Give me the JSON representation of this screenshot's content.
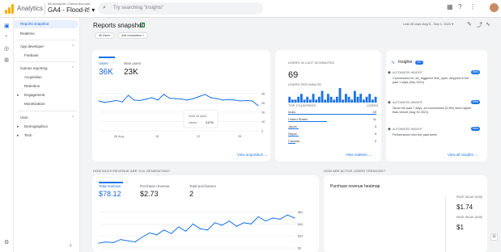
{
  "topbar": {
    "app_title": "Analytics",
    "account_path": "All accounts > Demo Account",
    "property": "GA4 - Flood-it! ▾",
    "search_placeholder": "Try searching \"insights\""
  },
  "nav": {
    "items": [
      {
        "label": "Reports snapshot"
      },
      {
        "label": "Realtime"
      },
      {
        "label": "App developer"
      },
      {
        "label": "Firebase"
      },
      {
        "label": "Games reporting"
      },
      {
        "label": "Acquisition"
      },
      {
        "label": "Retention"
      },
      {
        "label": "Engagement"
      },
      {
        "label": "Monetization"
      },
      {
        "label": "User"
      },
      {
        "label": "Demographics"
      },
      {
        "label": "Tech"
      }
    ]
  },
  "page": {
    "title": "Reports snapshot",
    "chip_comparison": "All Users",
    "chip_add": "Add comparison +",
    "date_range": "Last 28 days  Aug 5 - Sep 1, 2021 ▾"
  },
  "users_card": {
    "metrics": [
      {
        "label": "Users",
        "value": "36K"
      },
      {
        "label": "New users",
        "value": "23K"
      }
    ],
    "tooltip_date": "SUN 22 AUG",
    "tooltip_label": "Users",
    "tooltip_value": "3,678",
    "link": "View acquisition →"
  },
  "realtime_card": {
    "heading": "USERS IN LAST 30 MINUTES",
    "count": "69",
    "subheading": "USERS PER MINUTE",
    "table_head_left": "TOP COUNTRIES",
    "table_head_right": "USERS",
    "rows": [
      {
        "name": "India",
        "value": "25"
      },
      {
        "name": "United States",
        "value": "11"
      },
      {
        "name": "Japan",
        "value": "3"
      },
      {
        "name": "Nepal",
        "value": "3"
      },
      {
        "name": "Canada",
        "value": "2"
      }
    ],
    "per_minute": [
      2,
      1,
      1,
      2,
      3,
      1,
      2,
      1,
      3,
      1,
      2,
      4,
      1,
      3,
      2,
      1,
      2,
      5,
      1,
      3,
      2,
      1,
      4,
      2,
      3,
      1,
      2,
      3,
      1,
      2
    ],
    "link": "View realtime →"
  },
  "insights_card": {
    "title": "Insights",
    "badge": "10+",
    "items": [
      {
        "type": "AUTOMATED INSIGHT",
        "badge": "New",
        "text": "Conversions for 'ad_triggered' first_open' dropped in the past 1 days (Sep 2021)"
      },
      {
        "type": "AUTOMATED INSIGHT",
        "badge": "New",
        "text": "Since the past 7 days, ad conversions (9.8%) were higher than before (Aug 30 2021)"
      },
      {
        "type": "AUTOMATED INSIGHT",
        "badge": "New",
        "text": "Performance over the past week"
      }
    ],
    "link": "View all insights →"
  },
  "revenue_section": {
    "heading": "HOW MUCH REVENUE ARE YOU GENERATING?",
    "metrics": [
      {
        "label": "Total revenue",
        "value": "$78.12"
      },
      {
        "label": "Purchase revenue",
        "value": "$2.73"
      },
      {
        "label": "Total purchasers",
        "value": "2"
      }
    ]
  },
  "trend_section": {
    "heading": "HOW ARE ACTIVE USERS TRENDING?",
    "card_title": "Purchase revenue heatmap",
    "values": [
      {
        "label": "PAGE VALUE (USD)",
        "value": "$1.74"
      },
      {
        "label": "PAGE VALUE (USD)",
        "value": "$1"
      }
    ]
  },
  "chart_data": [
    {
      "type": "line",
      "title": "Users",
      "x": [
        "Aug 5",
        "Aug 6",
        "Aug 7",
        "Aug 8",
        "Aug 9",
        "Aug 10",
        "Aug 11",
        "Aug 12",
        "Aug 13",
        "Aug 14",
        "Aug 15",
        "Aug 16",
        "Aug 17",
        "Aug 18",
        "Aug 19",
        "Aug 20",
        "Aug 21",
        "Aug 22",
        "Aug 23",
        "Aug 24",
        "Aug 25",
        "Aug 26",
        "Aug 27",
        "Aug 28",
        "Aug 29",
        "Aug 30",
        "Aug 31",
        "Sep 1"
      ],
      "x_ticks": [
        "08 Aug",
        "15",
        "22",
        "29"
      ],
      "y_ticks": [
        "0",
        "1K",
        "2K",
        "3K",
        "4K"
      ],
      "ylim": [
        0,
        4500
      ],
      "series": [
        {
          "values": [
            3200,
            3050,
            3150,
            3250,
            3100,
            3800,
            3300,
            3250,
            3400,
            3550,
            3300,
            3900,
            3500,
            3450,
            3400,
            3300,
            3450,
            3678,
            3900,
            3550,
            3450,
            3300,
            3350,
            3300,
            3200,
            3250,
            3200,
            2700
          ]
        }
      ]
    },
    {
      "type": "line",
      "title": "Total revenue",
      "y_ticks": [
        "$0",
        "$20",
        "$40",
        "$60"
      ],
      "ylim": [
        0,
        70
      ],
      "series": [
        {
          "values": [
            8,
            10,
            9,
            14,
            12,
            10,
            18,
            25,
            22,
            30,
            24,
            35,
            28,
            40,
            32,
            30,
            42,
            38,
            45,
            36,
            42,
            40,
            52,
            45,
            50,
            48,
            55,
            50
          ]
        }
      ]
    }
  ]
}
